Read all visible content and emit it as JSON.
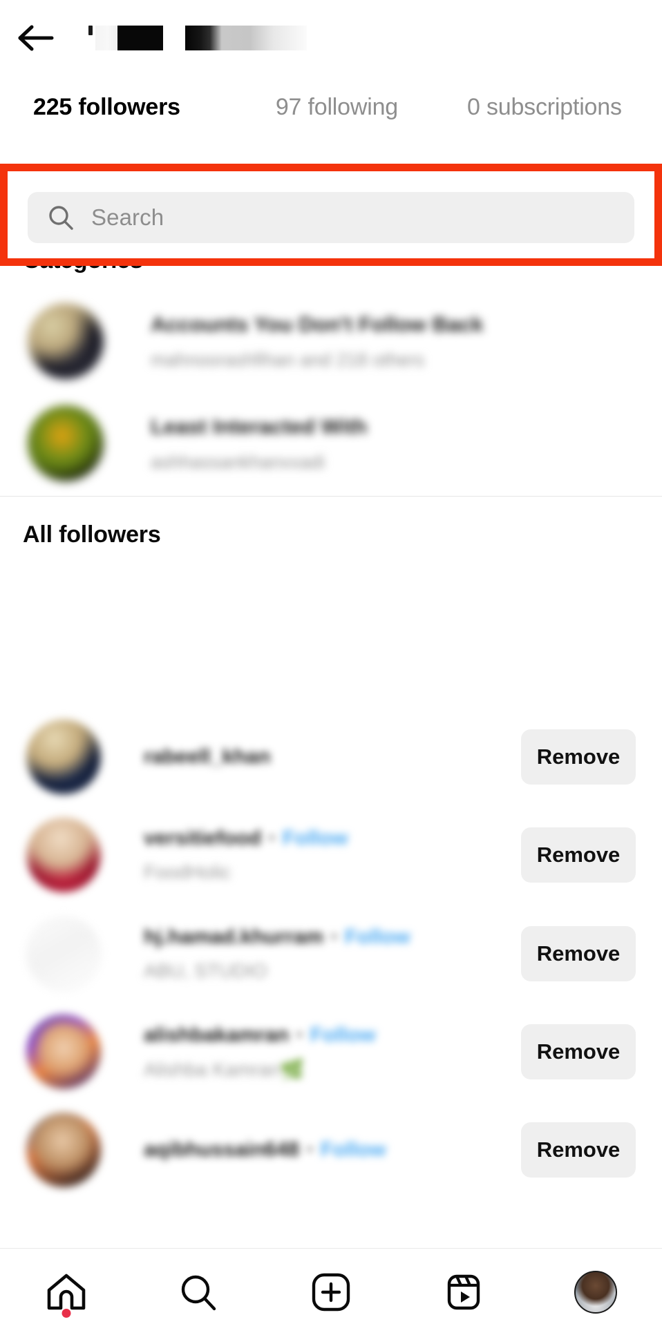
{
  "header": {
    "back_icon": "arrow-left-icon",
    "username_redacted": true
  },
  "tabs": [
    {
      "label": "225 followers",
      "active": true,
      "count": 225,
      "name": "followers"
    },
    {
      "label": "97 following",
      "active": false,
      "count": 97,
      "name": "following"
    },
    {
      "label": "0 subscriptions",
      "active": false,
      "count": 0,
      "name": "subscriptions"
    }
  ],
  "search": {
    "placeholder": "Search",
    "value": "",
    "icon": "search-icon",
    "highlighted": true,
    "highlight_color": "#F4330C"
  },
  "categories": {
    "heading": "Categories",
    "items": [
      {
        "title": "Accounts You Don't Follow Back",
        "subtitle": "mahnoorashfihan and 218 others",
        "blurred": true
      },
      {
        "title": "Least Interacted With",
        "subtitle": "ashhassankhanxxadi",
        "blurred": true
      }
    ]
  },
  "all_followers": {
    "heading": "All followers",
    "rows": [
      {
        "username": "rabeell_khan",
        "fullname": "",
        "follow_label": "",
        "action_label": "Remove",
        "blurred": true
      },
      {
        "username": "versitiefood",
        "fullname": "FoodHolic",
        "follow_label": "Follow",
        "action_label": "Remove",
        "blurred": true
      },
      {
        "username": "hj.hamad.khurram",
        "fullname": "ABU, STUDIO",
        "follow_label": "Follow",
        "action_label": "Remove",
        "blurred": true
      },
      {
        "username": "alishbakamran",
        "fullname": "Alishba Kamran",
        "fullname_emoji": "🌿",
        "follow_label": "Follow",
        "action_label": "Remove",
        "blurred": true
      },
      {
        "username": "aqibhussain648",
        "fullname": "",
        "follow_label": "Follow",
        "action_label": "Remove",
        "blurred": true
      }
    ]
  },
  "bottom_nav": {
    "items": [
      {
        "name": "home",
        "icon": "home-icon",
        "badge": true,
        "badge_color": "#E8304A"
      },
      {
        "name": "search",
        "icon": "search-icon",
        "badge": false
      },
      {
        "name": "create",
        "icon": "plus-square-icon",
        "badge": false
      },
      {
        "name": "reels",
        "icon": "reels-icon",
        "badge": false
      },
      {
        "name": "profile",
        "icon": "profile-avatar-icon",
        "badge": false
      }
    ]
  },
  "colors": {
    "accent_blue": "#4aa9f2",
    "highlight_red": "#F4330C",
    "chip_gray": "#efefef",
    "muted_text": "#8e8e8e"
  }
}
